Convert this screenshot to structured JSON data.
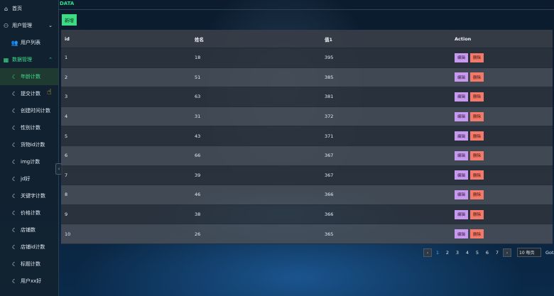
{
  "sidebar": {
    "home": "首页",
    "user_mgmt": "用户管理",
    "user_list": "用户列表",
    "data_mgmt": "数据管理",
    "items": [
      "年龄计数",
      "提交计数",
      "创建时间计数",
      "性别计数",
      "货物id计数",
      "img计数",
      "jd好",
      "关键字计数",
      "价格计数",
      "店铺数",
      "店铺id计数",
      "标题计数",
      "用户xx好"
    ]
  },
  "breadcrumb": "DATA",
  "add_button": "新增",
  "table": {
    "headers": [
      "id",
      "姓名",
      "值1",
      "Action"
    ],
    "rows": [
      [
        "1",
        "18",
        "395"
      ],
      [
        "2",
        "51",
        "385"
      ],
      [
        "3",
        "63",
        "381"
      ],
      [
        "4",
        "31",
        "372"
      ],
      [
        "5",
        "43",
        "371"
      ],
      [
        "6",
        "66",
        "367"
      ],
      [
        "7",
        "39",
        "367"
      ],
      [
        "8",
        "46",
        "366"
      ],
      [
        "9",
        "38",
        "366"
      ],
      [
        "10",
        "26",
        "365"
      ]
    ],
    "edit_label": "编辑",
    "delete_label": "删除"
  },
  "pagination": {
    "pages": [
      "1",
      "2",
      "3",
      "4",
      "5",
      "6",
      "7"
    ],
    "current": "1",
    "page_size": "10 每页",
    "goto": "Goto"
  },
  "colors": {
    "accent": "#3ddc84",
    "edit": "#c79af0",
    "delete": "#f27a6a"
  }
}
